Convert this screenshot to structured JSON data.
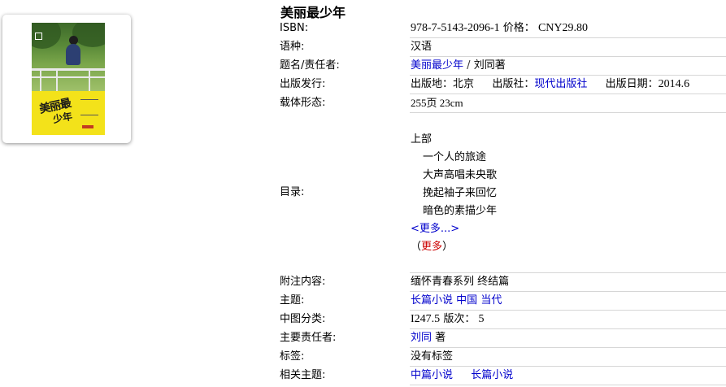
{
  "book": {
    "title": "美丽最少年",
    "cover_title_art_line1": "美丽最",
    "cover_title_art_line2": "少年"
  },
  "rows": {
    "isbn": {
      "label": "ISBN:",
      "isbn_value": "978-7-5143-2096-1",
      "price_label": "价格：",
      "price_value": "CNY29.80"
    },
    "language": {
      "label": "语种:",
      "value": "汉语"
    },
    "title_author": {
      "label": "题名/责任者:",
      "title_link": "美丽最少年",
      "separator": "/",
      "author_text": "刘同著"
    },
    "publication": {
      "label": "出版发行:",
      "place_label": "出版地：",
      "place_value": "北京",
      "publisher_label": "出版社：",
      "publisher_link": "现代出版社",
      "date_label": "出版日期：",
      "date_value": "2014.6"
    },
    "physical": {
      "label": "载体形态:",
      "value": "255页 23cm"
    },
    "toc": {
      "label": "目录:",
      "part": "上部",
      "chapters": [
        "一个人的旅途",
        "大声高唱未央歌",
        "挽起袖子来回忆",
        "暗色的素描少年"
      ],
      "more_link": "<更多...>",
      "more_paren_open": "（",
      "more_red": "更多",
      "more_paren_close": "）"
    },
    "notes": {
      "label": "附注内容:",
      "value": "缅怀青春系列 终结篇"
    },
    "subject": {
      "label": "主题:",
      "links": [
        "长篇小说",
        "中国",
        "当代"
      ]
    },
    "classification": {
      "label": "中图分类:",
      "value": "I247.5",
      "edition_label": "版次：",
      "edition_value": "5"
    },
    "main_author": {
      "label": "主要责任者:",
      "author_link": "刘同",
      "role": "著"
    },
    "tags": {
      "label": "标签:",
      "value": "没有标签"
    },
    "related": {
      "label": "相关主题:",
      "links": [
        "中篇小说",
        "长篇小说"
      ]
    }
  },
  "colors": {
    "link": "#0000cc",
    "more_red": "#cc0000",
    "cover_yellow": "#f3e21a"
  }
}
